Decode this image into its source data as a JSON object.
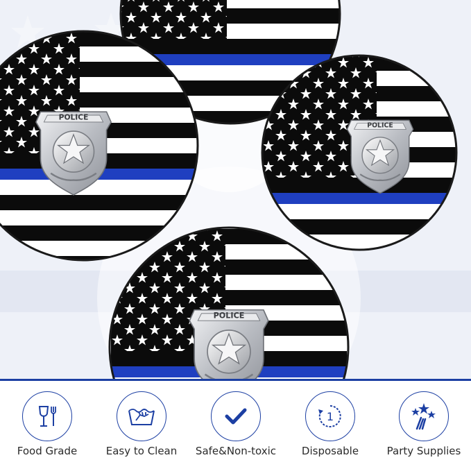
{
  "image": {
    "badge_text": "POLICE",
    "colors": {
      "plate_black": "#0b0b0b",
      "plate_white": "#ffffff",
      "thin_blue_line": "#1f3fc0",
      "badge_silver": "#c7c9cd",
      "background": "#f4f6fb",
      "accent_blue": "#1c3fa3"
    }
  },
  "features": [
    {
      "label": "Food Grade",
      "icon": "fork-glass-icon"
    },
    {
      "label": "Easy to Clean",
      "icon": "hand-wash-icon"
    },
    {
      "label": "Safe&Non-toxic",
      "icon": "checkmark-icon"
    },
    {
      "label": "Disposable",
      "icon": "disposable-cycle-icon"
    },
    {
      "label": "Party Supplies",
      "icon": "party-stars-icon"
    }
  ]
}
